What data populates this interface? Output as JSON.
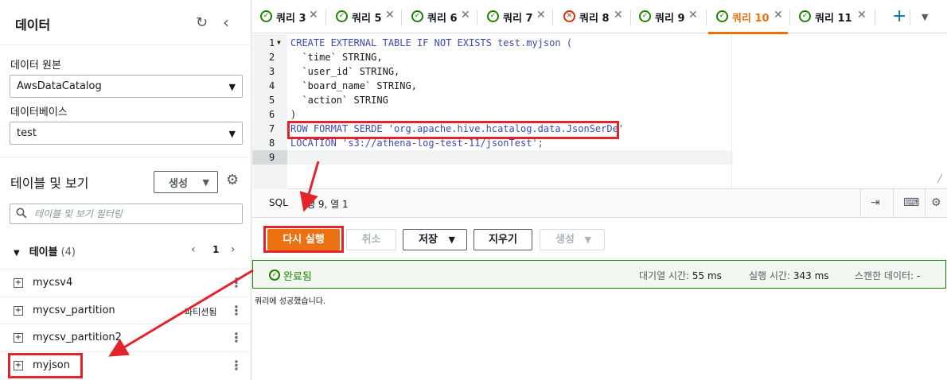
{
  "sidebar": {
    "title": "데이터",
    "datasource_label": "데이터 원본",
    "datasource_value": "AwsDataCatalog",
    "database_label": "데이터베이스",
    "database_value": "test",
    "tables_views_title": "테이블 및 보기",
    "create_label": "생성",
    "filter_placeholder": "테이블 및 보기 필터링",
    "tables_header": "테이블",
    "tables_count": "(4)",
    "page": "1",
    "tables": [
      {
        "name": "mycsv4",
        "badge": ""
      },
      {
        "name": "mycsv_partition",
        "badge": "파티션됨"
      },
      {
        "name": "mycsv_partition2",
        "badge": ""
      },
      {
        "name": "myjson",
        "badge": ""
      }
    ]
  },
  "tabs": [
    {
      "label": "쿼리 3",
      "status": "success"
    },
    {
      "label": "쿼리 5",
      "status": "success"
    },
    {
      "label": "쿼리 6",
      "status": "success"
    },
    {
      "label": "쿼리 7",
      "status": "success"
    },
    {
      "label": "쿼리 8",
      "status": "error"
    },
    {
      "label": "쿼리 9",
      "status": "success"
    },
    {
      "label": "쿼리 10",
      "status": "success",
      "active": true
    },
    {
      "label": "쿼리 11",
      "status": "success"
    }
  ],
  "editor": {
    "line_numbers": [
      "1",
      "2",
      "3",
      "4",
      "5",
      "6",
      "7",
      "8",
      "9"
    ],
    "lines": [
      "CREATE EXTERNAL TABLE IF NOT EXISTS test.myjson (",
      "  `time` STRING,",
      "  `user_id` STRING,",
      "  `board_name` STRING,",
      "  `action` STRING",
      ")",
      "ROW FORMAT SERDE 'org.apache.hive.hcatalog.data.JsonSerDe'",
      "LOCATION 's3://athena-log-test-11/jsonTest';",
      ""
    ]
  },
  "statusbar": {
    "language": "SQL",
    "cursor_position": "행 9, 열 1"
  },
  "actions": {
    "run_again": "다시 실행",
    "cancel": "취소",
    "save": "저장",
    "clear": "지우기",
    "create": "생성"
  },
  "result": {
    "status": "완료됨",
    "queue_time_label": "대기열 시간:",
    "queue_time_value": "55 ms",
    "run_time_label": "실행 시간:",
    "run_time_value": "343 ms",
    "scanned_label": "스캔한 데이터:",
    "scanned_value": "-",
    "message": "쿼리에 성공했습니다."
  },
  "colors": {
    "accent": "#ec7211",
    "success": "#1d8102",
    "error": "#d13212",
    "annotation": "#e3242b"
  }
}
